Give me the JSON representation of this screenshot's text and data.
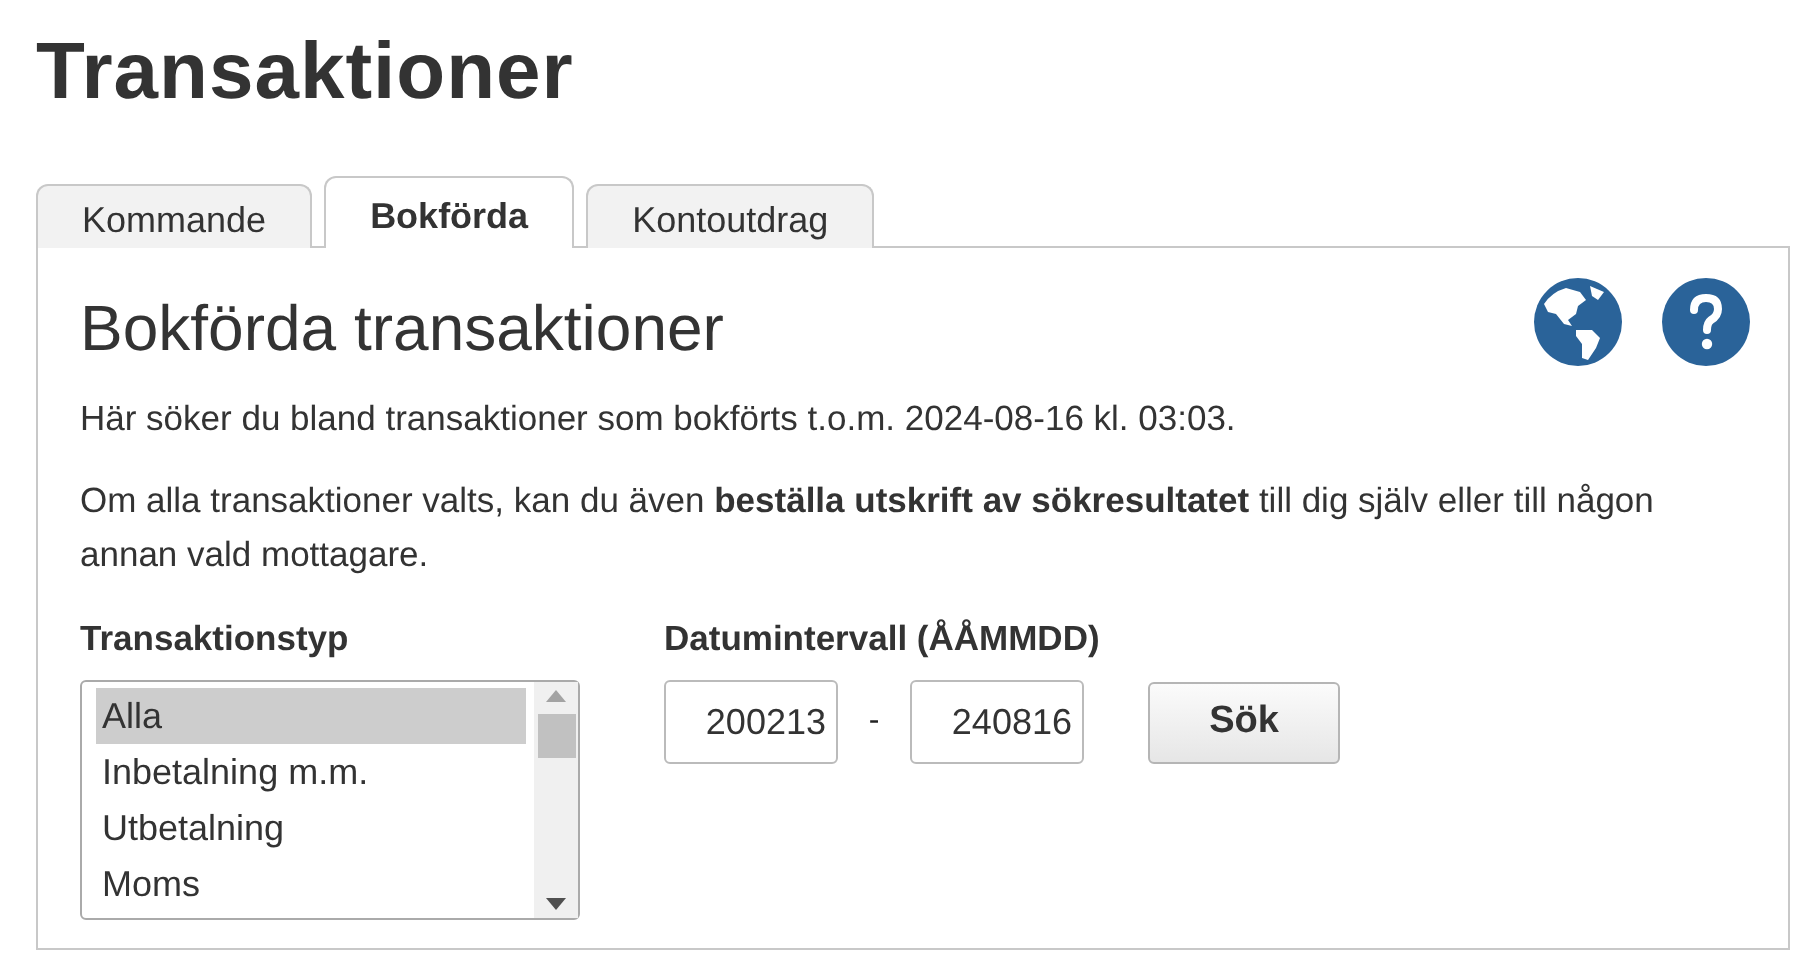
{
  "page_title": "Transaktioner",
  "tabs": [
    {
      "label": "Kommande",
      "selected": false
    },
    {
      "label": "Bokförda",
      "selected": true
    },
    {
      "label": "Kontoutdrag",
      "selected": false
    }
  ],
  "panel": {
    "heading": "Bokförda transaktioner",
    "intro": "Här söker du bland transaktioner som bokförts t.o.m. 2024-08-16 kl. 03:03.",
    "note": "Om alla transaktioner valts, kan du även **beställa utskrift av sökresultatet** till dig själv eller till någon annan vald mottagare.",
    "type_label": "Transaktionstyp",
    "types": [
      {
        "label": "Alla",
        "selected": true
      },
      {
        "label": "Inbetalning m.m.",
        "selected": false
      },
      {
        "label": "Utbetalning",
        "selected": false
      },
      {
        "label": "Moms",
        "selected": false
      }
    ],
    "date_label": "Datumintervall (ÅÅMMDD)",
    "date_from": "200213",
    "separator": "-",
    "date_to": "240816",
    "search_button": "Sök"
  }
}
